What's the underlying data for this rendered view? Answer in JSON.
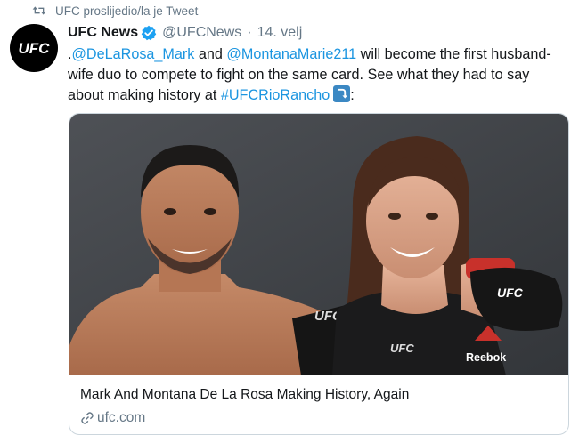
{
  "retweet": {
    "icon": "retweet-icon",
    "label": "UFC proslijedio/la je Tweet"
  },
  "tweet": {
    "avatar_text": "UFC",
    "author_name": "UFC News",
    "verified_icon": "verified-badge-icon",
    "handle": "@UFCNews",
    "separator": "·",
    "date": "14. velj",
    "text": {
      "lead": ".",
      "mention1": "@DeLaRosa_Mark",
      "and": " and ",
      "mention2": "@MontanaMarie211",
      "body": " will become the first husband-wife duo to compete to fight on the same card. See what they had to say about making history at ",
      "hashtag": "#UFCRioRancho",
      "emoji": "arrow-curving-down-emoji",
      "tail": ":"
    },
    "card": {
      "image_text": {
        "shorts_logo": "UFC",
        "bra_logo": "UFC",
        "glove_logo": "UFC",
        "brand": "Reebok"
      },
      "title": "Mark And Montana De La Rosa Making History, Again",
      "domain_icon": "link-icon",
      "domain": "ufc.com"
    }
  },
  "colors": {
    "link": "#1b95e0",
    "secondary_text": "#657786",
    "verified": "#1da1f2",
    "border": "#ccd6dd"
  }
}
